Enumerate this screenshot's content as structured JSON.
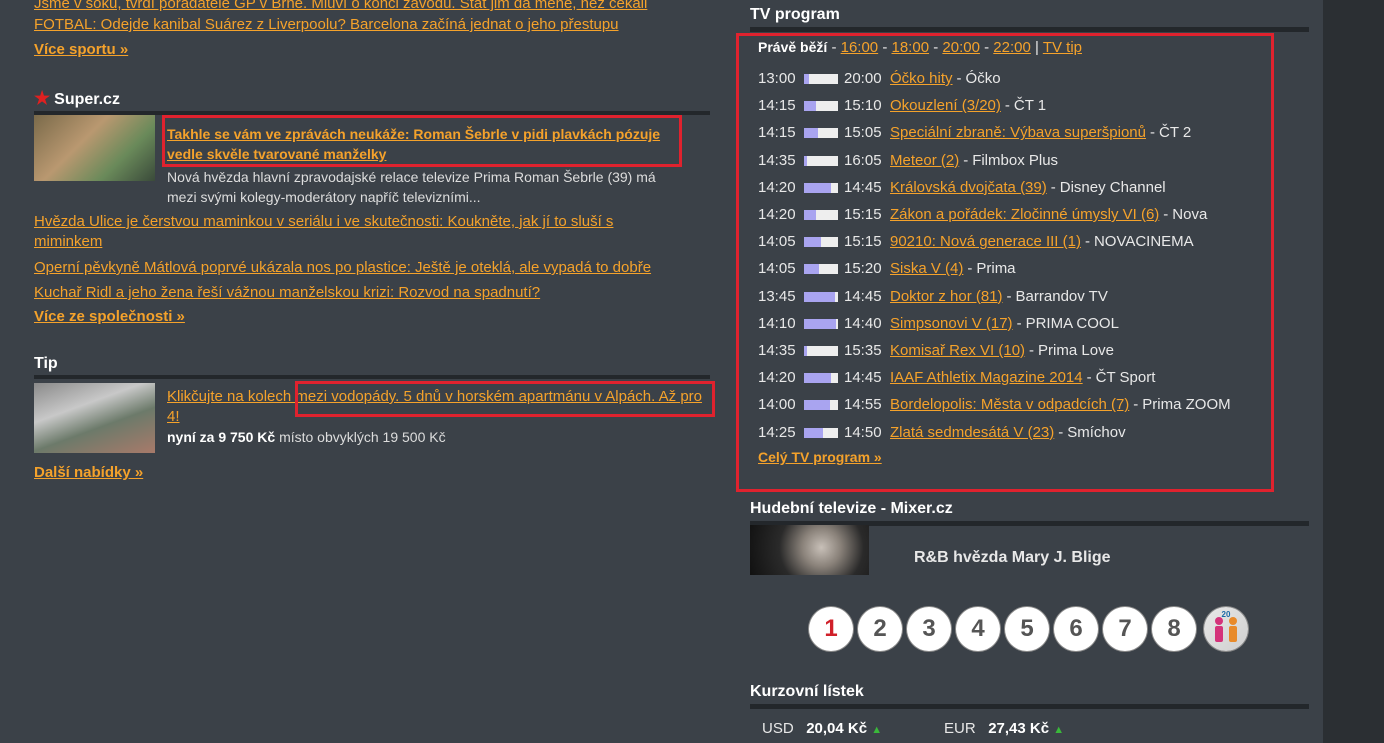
{
  "sport": {
    "lines": [
      "Jsme v šoku, tvrdí pořadatelé GP v Brně. Mluví o konci závodů. Stát jim dá méně, než čekali",
      "FOTBAL: Odejde kanibal Suárez z Liverpoolu? Barcelona začíná jednat o jeho přestupu"
    ],
    "more": "Více sportu »"
  },
  "super": {
    "heading": "Super.cz",
    "headline": "Takhle se vám ve zprávách neukáže: Roman Šebrle v pidi plavkách pózuje vedle skvěle tvarované manželky",
    "perex": "Nová hvězda hlavní zpravodajské relace televize Prima Roman Šebrle (39) má mezi svými kolegy-moderátory napříč televizními...",
    "links": [
      "Hvězda Ulice je čerstvou maminkou v seriálu i ve skutečnosti: Koukněte, jak jí to sluší s miminkem",
      "Operní pěvkyně Mátlová poprvé ukázala nos po plastice: Ještě je oteklá, ale vypadá to dobře",
      "Kuchař Ridl a jeho žena řeší vážnou manželskou krizi: Rozvod na spadnutí?"
    ],
    "more": "Více ze společnosti »"
  },
  "tip": {
    "heading": "Tip",
    "headline": "Klikčujte na kolech mezi vodopády. 5 dnů v horském apartmánu v Alpách. Až pro 4!",
    "price_label": "nyní za 9 750 Kč",
    "price_note": "místo obvyklých 19 500 Kč",
    "more": "Další nabídky »"
  },
  "tv": {
    "heading": "TV program",
    "now_label": "Právě běží",
    "sep": "-",
    "times": [
      "16:00",
      "18:00",
      "20:00",
      "22:00"
    ],
    "pipe": "|",
    "tip": "TV tip",
    "rows": [
      {
        "start": "13:00",
        "end": "20:00",
        "title": "Óčko hity",
        "channel": "Óčko",
        "progress": 0.15
      },
      {
        "start": "14:15",
        "end": "15:10",
        "title": "Okouzlení (3/20)",
        "channel": "ČT 1",
        "progress": 0.35
      },
      {
        "start": "14:15",
        "end": "15:05",
        "title": "Speciální zbraně: Výbava superšpionů",
        "channel": "ČT 2",
        "progress": 0.4
      },
      {
        "start": "14:35",
        "end": "16:05",
        "title": "Meteor (2)",
        "channel": "Filmbox Plus",
        "progress": 0.1
      },
      {
        "start": "14:20",
        "end": "14:45",
        "title": "Královská dvojčata (39)",
        "channel": "Disney Channel",
        "progress": 0.8
      },
      {
        "start": "14:20",
        "end": "15:15",
        "title": "Zákon a pořádek: Zločinné úmysly VI (6)",
        "channel": "Nova",
        "progress": 0.35
      },
      {
        "start": "14:05",
        "end": "15:15",
        "title": "90210: Nová generace III (1)",
        "channel": "NOVACINEMA",
        "progress": 0.5
      },
      {
        "start": "14:05",
        "end": "15:20",
        "title": "Siska V (4)",
        "channel": "Prima",
        "progress": 0.45
      },
      {
        "start": "13:45",
        "end": "14:45",
        "title": "Doktor z hor (81)",
        "channel": "Barrandov TV",
        "progress": 0.9
      },
      {
        "start": "14:10",
        "end": "14:40",
        "title": "Simpsonovi V (17)",
        "channel": "PRIMA COOL",
        "progress": 0.95
      },
      {
        "start": "14:35",
        "end": "15:35",
        "title": "Komisař Rex VI (10)",
        "channel": "Prima Love",
        "progress": 0.1
      },
      {
        "start": "14:20",
        "end": "14:45",
        "title": "IAAF Athletix Magazine 2014",
        "channel": "ČT Sport",
        "progress": 0.8
      },
      {
        "start": "14:00",
        "end": "14:55",
        "title": "Bordelopolis: Města v odpadcích (7)",
        "channel": "Prima ZOOM",
        "progress": 0.75
      },
      {
        "start": "14:25",
        "end": "14:50",
        "title": "Zlatá sedmdesátá V (23)",
        "channel": "Smíchov",
        "progress": 0.55
      }
    ],
    "full": "Celý TV program »"
  },
  "music": {
    "heading": "Hudební televize - Mixer.cz",
    "caption": "R&B hvězda Mary J. Blige"
  },
  "pager": [
    "1",
    "2",
    "3",
    "4",
    "5",
    "6",
    "7",
    "8"
  ],
  "pager_last": "20",
  "rates": {
    "heading": "Kurzovní lístek",
    "items": [
      {
        "code": "USD",
        "value": "20,04 Kč"
      },
      {
        "code": "EUR",
        "value": "27,43 Kč"
      }
    ]
  },
  "colors": {
    "accent": "#f5a22b",
    "highlight": "#e0222e",
    "background": "#3b4148"
  }
}
